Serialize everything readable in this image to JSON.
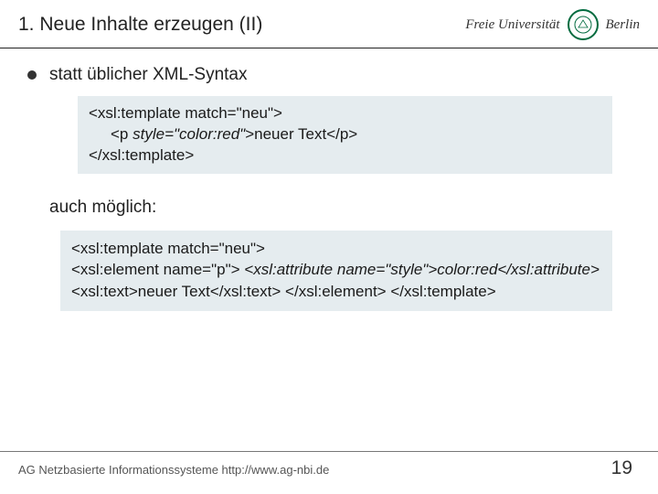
{
  "header": {
    "title": "1. Neue Inhalte erzeugen (II)",
    "uni_prefix": "Freie Universität",
    "uni_city": "Berlin"
  },
  "bullet": {
    "text": "statt üblicher XML-Syntax"
  },
  "code1": {
    "l1a": "<xsl:template match=\"neu\">",
    "l2a": "<p ",
    "l2b": "style=\"color:red\"",
    "l2c": ">neuer Text</p>",
    "l3a": "</xsl:template>"
  },
  "also": {
    "text": "auch möglich:"
  },
  "code2": {
    "l1": "<xsl:template match=\"neu\">",
    "l2": "<xsl:element name=\"p\">",
    "l3a": "<xsl:attribute name=\"style\">",
    "l3b": "color:red",
    "l3c": "</xsl:attribute>",
    "l4": "<xsl:text>neuer Text</xsl:text>",
    "l5": "</xsl:element>",
    "l6": "</xsl:template>"
  },
  "footer": {
    "left": "AG Netzbasierte Informationssysteme http://www.ag-nbi.de",
    "page": "19"
  }
}
